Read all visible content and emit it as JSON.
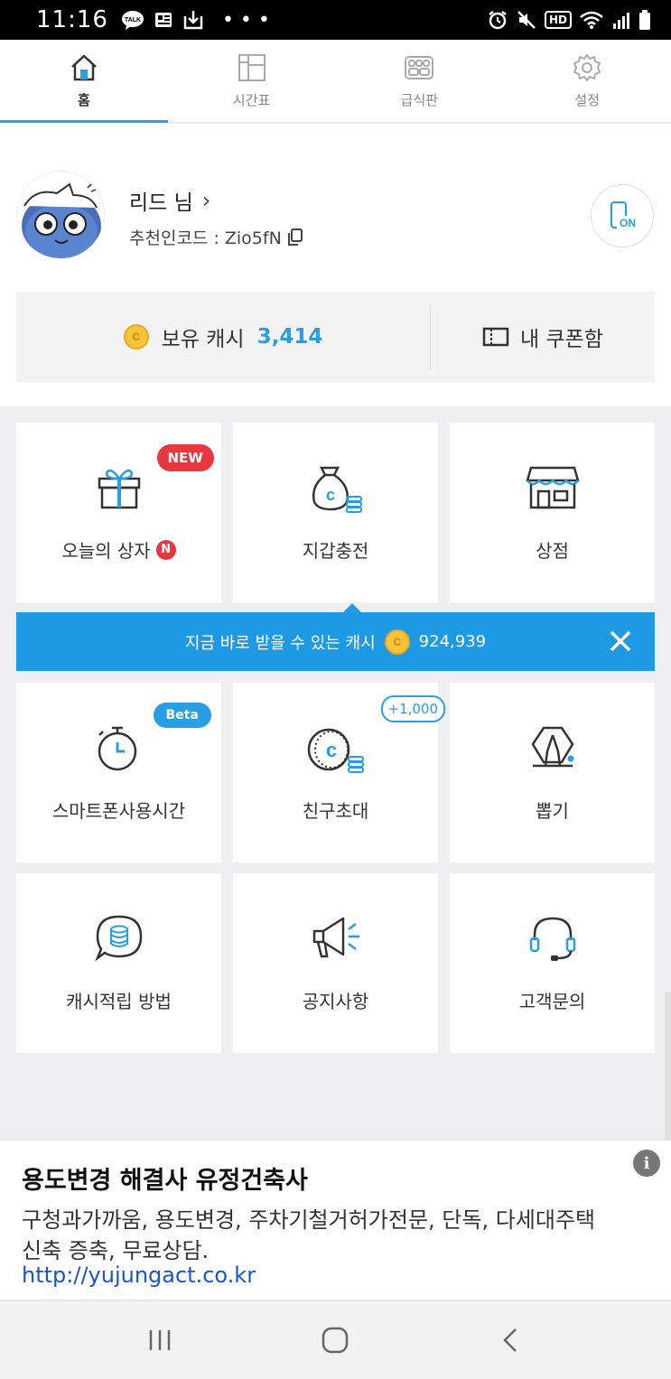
{
  "status_bar": {
    "time": "11:16",
    "left_icons": [
      "talk-icon",
      "news-icon",
      "download-icon",
      "more-icon"
    ],
    "right_icons": [
      "alarm-icon",
      "mute-icon",
      "hd-icon",
      "wifi-icon",
      "signal-icon",
      "battery-icon"
    ],
    "hd_label": "HD"
  },
  "nav": {
    "tabs": [
      {
        "label": "홈",
        "icon": "home-icon",
        "active": true
      },
      {
        "label": "시간표",
        "icon": "timetable-icon",
        "active": false
      },
      {
        "label": "급식판",
        "icon": "meal-tray-icon",
        "active": false
      },
      {
        "label": "설정",
        "icon": "gear-icon",
        "active": false
      }
    ]
  },
  "profile": {
    "name": "리드 님",
    "chevron": "›",
    "code_label": "추천인코드 : Zio5fN",
    "on_label": "ON"
  },
  "cash": {
    "label": "보유 캐시",
    "value": "3,414",
    "coupon_label": "내 쿠폰함"
  },
  "tiles": [
    {
      "label": "오늘의 상자",
      "icon": "gift-icon",
      "badge": "NEW",
      "dot": "N"
    },
    {
      "label": "지갑충전",
      "icon": "money-bag-icon"
    },
    {
      "label": "상점",
      "icon": "store-icon"
    },
    {
      "label": "스마트폰사용시간",
      "icon": "stopwatch-icon",
      "badge": "Beta"
    },
    {
      "label": "친구초대",
      "icon": "coin-stack-icon",
      "badge": "+1,000"
    },
    {
      "label": "뽑기",
      "icon": "claw-machine-icon"
    },
    {
      "label": "캐시적립 방법",
      "icon": "chat-coin-icon"
    },
    {
      "label": "공지사항",
      "icon": "megaphone-icon"
    },
    {
      "label": "고객문의",
      "icon": "headset-icon"
    }
  ],
  "banner": {
    "text": "지금 바로 받을 수 있는 캐시",
    "value": "924,939"
  },
  "ad": {
    "title": "용도변경 해결사 유정건축사",
    "description": "구청과가까움, 용도변경, 주차기철거허가전문, 단독, 다세대주택신축 증축, 무료상담.",
    "url": "http://yujungact.co.kr",
    "info": "i"
  },
  "colors": {
    "accent": "#2a9ee4",
    "banner": "#1d9ae3",
    "badge_red": "#e8383f",
    "coin": "#f6c33b"
  }
}
